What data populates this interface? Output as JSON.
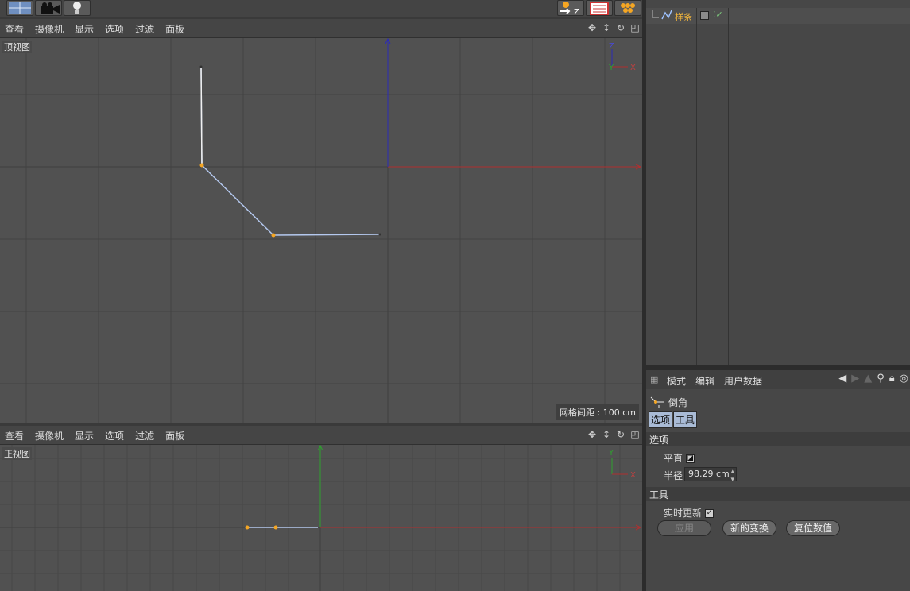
{
  "viewport_menu": [
    "查看",
    "摄像机",
    "显示",
    "选项",
    "过滤",
    "面板"
  ],
  "top_view": {
    "label": "顶视图",
    "grid_spacing": "网格间距 : 100 cm",
    "axis_gizmo": {
      "z": "Z",
      "y": "Y",
      "x": "X"
    }
  },
  "front_view": {
    "label": "正视图",
    "axis_gizmo": {
      "y": "Y",
      "x": "X"
    }
  },
  "object_manager": {
    "object_name": "样条"
  },
  "attributes": {
    "toolbar": [
      "模式",
      "编辑",
      "用户数据"
    ],
    "tool_name": "倒角",
    "tabs": [
      "选项",
      "工具"
    ],
    "section_options": "选项",
    "flat_label": "平直",
    "radius_label": "半径",
    "radius_value": "98.29 cm",
    "section_tool": "工具",
    "realtime_label": "实时更新",
    "buttons": {
      "apply": "应用",
      "new_transform": "新的变换",
      "reset": "复位数值"
    }
  },
  "colors": {
    "spline": "#b4c8ee",
    "point": "#f5a623",
    "axis_x": "#b03030",
    "axis_y": "#2fa12f",
    "axis_z": "#2a2ab8"
  }
}
